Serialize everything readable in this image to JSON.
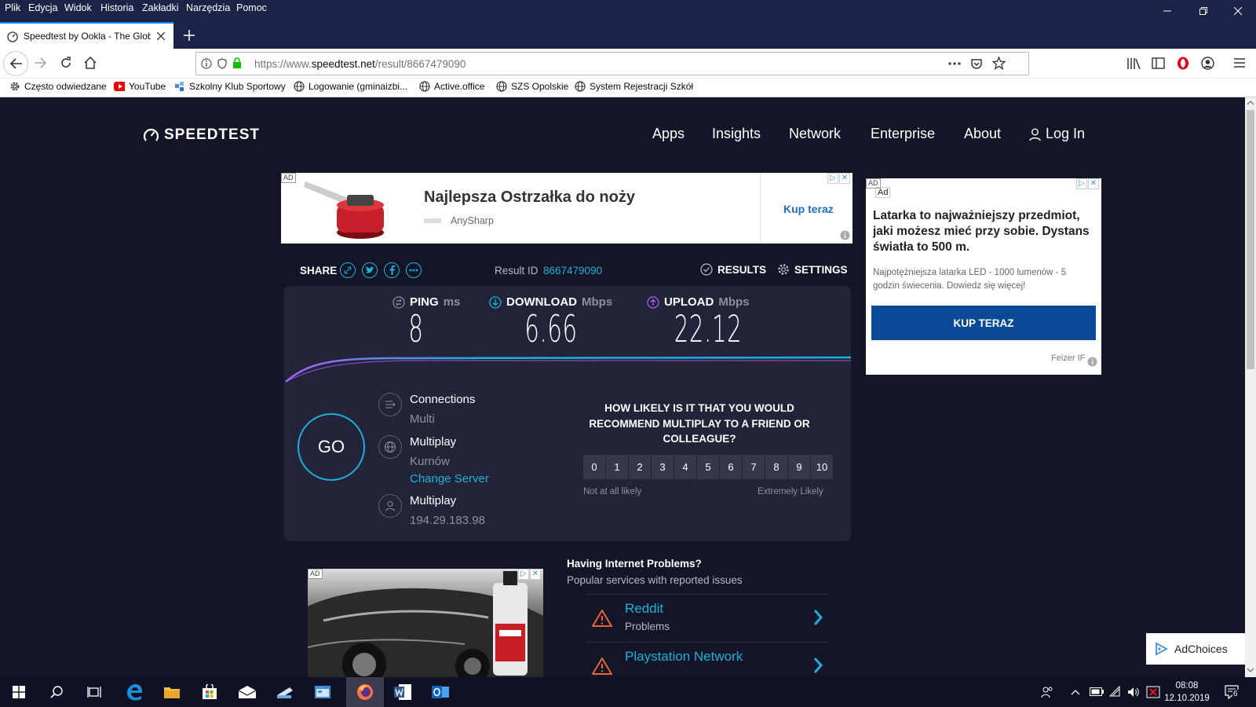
{
  "menubar": {
    "items": [
      "Plik",
      "Edycja",
      "Widok",
      "Historia",
      "Zakładki",
      "Narzędzia",
      "Pomoc"
    ]
  },
  "tab": {
    "title": "Speedtest by Ookla - The Global Broadband Speed Test"
  },
  "urlbar": {
    "url_prefix": "https://www.",
    "url_host": "speedtest.net",
    "url_path": "/result/8667479090"
  },
  "bookmarks": [
    "Często odwiedzane",
    "YouTube",
    "Szkolny Klub Sportowy",
    "Logowanie (gminaizbi...",
    "Active.office",
    "SZS Opolskie",
    "System Rejestracji Szkół"
  ],
  "site": {
    "logo_text": "SPEEDTEST",
    "nav": [
      "Apps",
      "Insights",
      "Network",
      "Enterprise",
      "About"
    ],
    "login_label": "Log In"
  },
  "ad_top": {
    "tag": "AD",
    "headline": "Najlepsza Ostrzałka do noży",
    "brand": "AnySharp",
    "cta": "Kup teraz"
  },
  "ad_side": {
    "tag": "AD",
    "sub_tag": "Ad",
    "headline": "Latarka to najważniejszy przedmiot, jaki możesz mieć przy sobie. Dystans światła to 500 m.",
    "body": "Najpotężniejsza latarka LED - 1000 lumenów - 5 godzin świecenia. Dowiedz się więcej!",
    "cta": "KUP TERAZ",
    "advertiser": "Feizer IF"
  },
  "share": {
    "label": "SHARE",
    "result_label": "Result ID",
    "result_id": "8667479090",
    "results_label": "RESULTS",
    "settings_label": "SETTINGS"
  },
  "metrics": {
    "ping": {
      "label": "PING",
      "unit": "ms",
      "value": "8"
    },
    "download": {
      "label": "DOWNLOAD",
      "unit": "Mbps",
      "value": "6.66"
    },
    "upload": {
      "label": "UPLOAD",
      "unit": "Mbps",
      "value": "22.12"
    }
  },
  "go_label": "GO",
  "connections": {
    "title": "Connections",
    "value": "Multi"
  },
  "server": {
    "title": "Multiplay",
    "location": "Kurnów",
    "change_label": "Change Server"
  },
  "isp": {
    "title": "Multiplay",
    "ip": "194.29.183.98"
  },
  "nps": {
    "question": "HOW LIKELY IS IT THAT YOU WOULD RECOMMEND MULTIPLAY TO A FRIEND OR COLLEAGUE?",
    "scale": [
      "0",
      "1",
      "2",
      "3",
      "4",
      "5",
      "6",
      "7",
      "8",
      "9",
      "10"
    ],
    "low_label": "Not at all likely",
    "high_label": "Extremely Likely"
  },
  "problems": {
    "heading": "Having Internet Problems?",
    "subheading": "Popular services with reported issues",
    "items": [
      {
        "name": "Reddit",
        "status": "Problems"
      },
      {
        "name": "Playstation Network",
        "status": ""
      }
    ]
  },
  "adchoices": {
    "label": "AdChoices"
  },
  "taskbar": {
    "time": "08:08",
    "date": "12.10.2019",
    "notification_count": "6"
  },
  "colors": {
    "accent": "#1ab1d9",
    "page_bg": "#141526",
    "panel_bg": "#23243a",
    "side_ad_cta": "#0c4a97"
  }
}
